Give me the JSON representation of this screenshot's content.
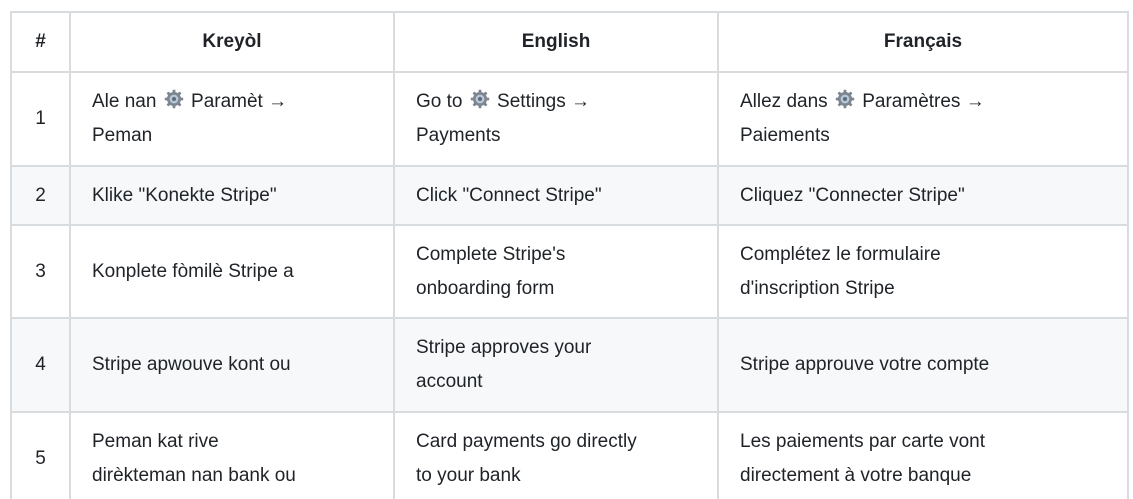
{
  "table": {
    "headers": [
      "#",
      "Kreyòl",
      "English",
      "Français"
    ],
    "rows": [
      {
        "num": "1",
        "kreyol": {
          "pre": "Ale nan",
          "post": "Paramèt →",
          "line2": "Peman"
        },
        "english": {
          "pre": "Go to",
          "post": "Settings →",
          "line2": "Payments"
        },
        "francais": {
          "pre": "Allez dans",
          "post": "Paramètres →",
          "line2": "Paiements"
        },
        "icon": "gear-icon"
      },
      {
        "num": "2",
        "kreyol": "Klike \"Konekte Stripe\"",
        "english": "Click \"Connect Stripe\"",
        "francais": "Cliquez \"Connecter Stripe\""
      },
      {
        "num": "3",
        "kreyol": "Konplete fòmilè Stripe a",
        "english": {
          "line1": "Complete Stripe's",
          "line2": "onboarding form"
        },
        "francais": {
          "line1": "Complétez le formulaire",
          "line2": "d'inscription Stripe"
        }
      },
      {
        "num": "4",
        "kreyol": "Stripe apwouve kont ou",
        "english": {
          "line1": "Stripe approves your",
          "line2": "account"
        },
        "francais": "Stripe approuve votre compte"
      },
      {
        "num": "5",
        "kreyol": {
          "line1": "Peman kat rive",
          "line2": "dirèkteman nan bank ou"
        },
        "english": {
          "line1": "Card payments go directly",
          "line2": "to your bank"
        },
        "francais": {
          "line1": "Les paiements par carte vont",
          "line2": "directement à votre banque"
        }
      }
    ]
  },
  "colors": {
    "border": "#d9dcdf",
    "stripe": "#f6f8fa",
    "text": "#1f2328",
    "gear_outer": "#7d8590",
    "gear_inner": "#b8c7d6"
  }
}
